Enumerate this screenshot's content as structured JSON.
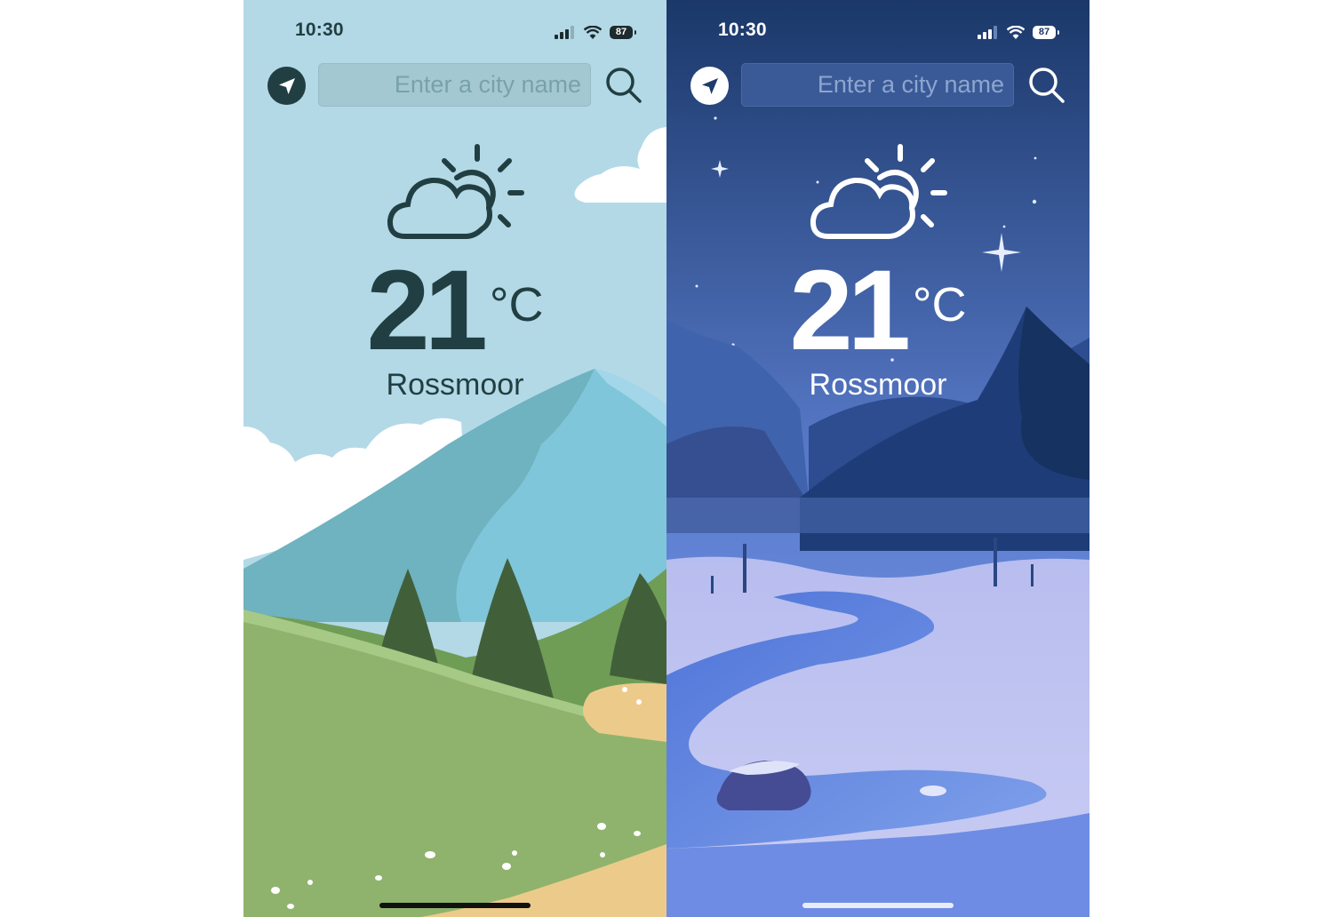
{
  "screens": [
    {
      "theme": "day",
      "status_bar": {
        "time": "10:30",
        "battery": "87"
      },
      "search": {
        "placeholder": "Enter a city name"
      },
      "weather": {
        "condition_icon": "partly-cloudy-icon",
        "temperature": "21",
        "unit": "°C",
        "city": "Rossmoor"
      },
      "colors": {
        "sky": "#b3d9e7",
        "text": "#213f42",
        "accent_mountain": "#7ec5d9",
        "grass": "#8fb36d"
      }
    },
    {
      "theme": "night",
      "status_bar": {
        "time": "10:30",
        "battery": "87"
      },
      "search": {
        "placeholder": "Enter a city name"
      },
      "weather": {
        "condition_icon": "partly-cloudy-icon",
        "temperature": "21",
        "unit": "°C",
        "city": "Rossmoor"
      },
      "colors": {
        "sky_top": "#1c3b6c",
        "sky_bottom": "#5e80d6",
        "text": "#ffffff",
        "snow": "#c9cef0",
        "river": "#5b7fe0"
      }
    }
  ]
}
